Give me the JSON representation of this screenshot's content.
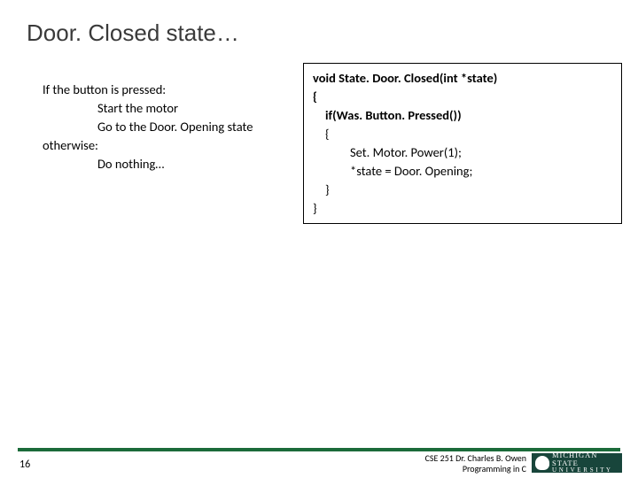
{
  "title": "Door. Closed state…",
  "pseudo": {
    "l1": "If the button is pressed:",
    "l2": "Start the motor",
    "l3": "Go to the Door. Opening state",
    "l4": "otherwise:",
    "l5": "Do nothing…"
  },
  "code": {
    "l1": "void State. Door. Closed(int *state)",
    "l2": "{",
    "l3": "if(Was. Button. Pressed())",
    "l4": "{",
    "l5": "Set. Motor. Power(1);",
    "l6": "*state = Door. Opening;",
    "l7": "}",
    "l8": "}"
  },
  "footer": {
    "page": "16",
    "line1": "CSE 251 Dr. Charles B. Owen",
    "line2": "Programming in C",
    "logo_top": "MICHIGAN STATE",
    "logo_bottom": "U N I V E R S I T Y"
  }
}
